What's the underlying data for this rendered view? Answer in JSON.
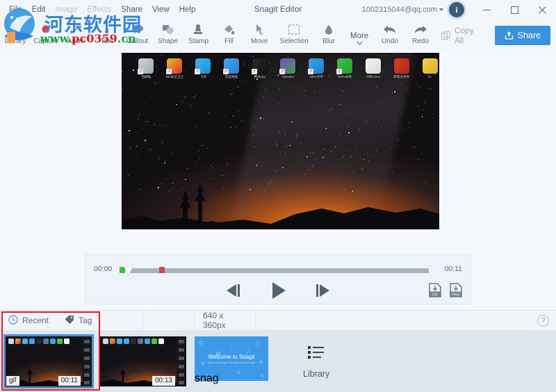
{
  "window": {
    "title": "Snagit Editor",
    "account": "1002315044@qq.com",
    "info_icon": "info-icon",
    "minimize_label": "Minimize",
    "maximize_label": "Maximize",
    "close_label": "Close"
  },
  "menubar": {
    "items": [
      {
        "label": "File",
        "disabled": false
      },
      {
        "label": "Edit",
        "disabled": false
      },
      {
        "label": "Image",
        "disabled": true
      },
      {
        "label": "Effects",
        "disabled": true
      },
      {
        "label": "Share",
        "disabled": false
      },
      {
        "label": "View",
        "disabled": false
      },
      {
        "label": "Help",
        "disabled": false
      }
    ]
  },
  "toolbar": {
    "tools": [
      {
        "label": "Library",
        "icon": "library-icon"
      },
      {
        "label": "Capture",
        "icon": "capture-record-icon"
      },
      {
        "label": "Arrow",
        "icon": "arrow-icon"
      },
      {
        "label": "Text",
        "icon": "text-icon"
      },
      {
        "label": "Callout",
        "icon": "callout-icon"
      },
      {
        "label": "Shape",
        "icon": "shape-icon"
      },
      {
        "label": "Stamp",
        "icon": "stamp-icon"
      },
      {
        "label": "Fill",
        "icon": "fill-bucket-icon"
      },
      {
        "label": "Move",
        "icon": "move-icon"
      },
      {
        "label": "Selection",
        "icon": "selection-marquee-icon"
      },
      {
        "label": "Blur",
        "icon": "blur-drop-icon"
      },
      {
        "label": "More",
        "icon": "more-chevron-icon"
      },
      {
        "label": "Undo",
        "icon": "undo-icon"
      },
      {
        "label": "Redo",
        "icon": "redo-icon"
      }
    ],
    "copy_all_label": "Copy All",
    "share_label": "Share"
  },
  "player": {
    "start_time": "00:00",
    "end_time": "00:11",
    "step_back_label": "Step Back",
    "play_label": "Play",
    "step_forward_label": "Step Forward",
    "export_gif_label": "GIF",
    "export_png_label": "PNG",
    "trim_start_marker": "green",
    "trim_end_marker": "red"
  },
  "tray_header": {
    "recent_label": "Recent",
    "tag_label": "Tag",
    "dimensions": "640 x 360px",
    "help_label": "?"
  },
  "tray": {
    "library_label": "Library",
    "items": [
      {
        "type_badge": "gif",
        "duration": "00:11",
        "selected": true,
        "kind": "video-thumbnail"
      },
      {
        "type_badge": "",
        "duration": "00:13",
        "selected": false,
        "kind": "video-thumbnail"
      },
      {
        "type_badge": "snag",
        "duration": "",
        "selected": false,
        "kind": "image-thumbnail",
        "tile_title": "Welcome to Snagit",
        "tile_subtitle": "Start here to get the most out of Snagit"
      }
    ]
  },
  "canvas": {
    "desktop_icons": [
      {
        "label": "回收站",
        "color1": "#cfd6dc",
        "color2": "#9aa6b0",
        "shortcut": true
      },
      {
        "label": "360安全卫士",
        "color1": "#e8c12a",
        "color2": "#d4342c",
        "shortcut": true
      },
      {
        "label": "飞书",
        "color1": "#3db4f2",
        "color2": "#1b8fd6",
        "shortcut": true
      },
      {
        "label": "百度网盘",
        "color1": "#4aa3ef",
        "color2": "#2a7fd4",
        "shortcut": true
      },
      {
        "label": "腾讯QQ",
        "color1": "#2b2b2b",
        "color2": "#111111",
        "shortcut": true
      },
      {
        "label": "VyEditor",
        "color1": "#7a4ecb",
        "color2": "#3f9e46",
        "shortcut": true
      },
      {
        "label": "WPS文字",
        "color1": "#3fa0e8",
        "color2": "#1f7fd0",
        "shortcut": true
      },
      {
        "label": "WPS表格",
        "color1": "#45c24a",
        "color2": "#1f9e2e",
        "shortcut": true
      },
      {
        "label": "声明.docx",
        "color1": "#f4f4f4",
        "color2": "#d9d9d9",
        "shortcut": false
      },
      {
        "label": "新建文件夹",
        "color1": "#d43a2e",
        "color2": "#b02a20",
        "shortcut": false
      },
      {
        "label": "lic",
        "color1": "#f1d24a",
        "color2": "#d8b227",
        "shortcut": false
      }
    ]
  },
  "watermark": {
    "chinese": "河东软件园",
    "url_prefix": "www.",
    "url_domain": "pc0359",
    "url_suffix": ".cn"
  },
  "colors": {
    "accent": "#3c91dd",
    "selection": "#4a90d9",
    "highlight_box": "#f4141c",
    "chrome": "#f2f6fb",
    "tray": "#dfe6ee"
  }
}
